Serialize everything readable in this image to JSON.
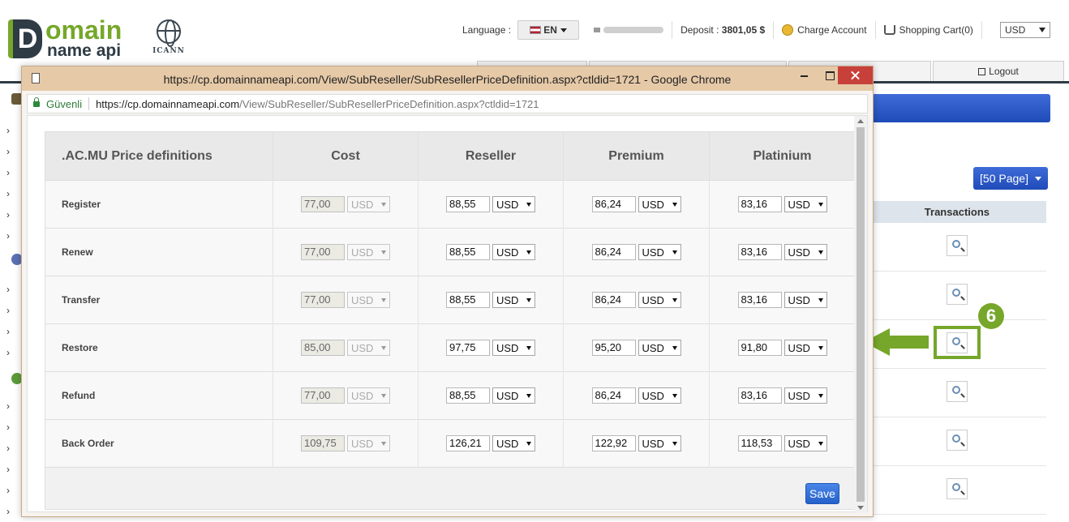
{
  "header": {
    "logo_word1": "omain",
    "logo_letter": "D",
    "logo_word2": "name api",
    "icann_text": "ICANN",
    "language_label": "Language :",
    "language_value": "EN",
    "deposit_label": "Deposit :",
    "deposit_value": "3801,05 $",
    "charge_account": "Charge Account",
    "shopping_cart": "Shopping Cart(0)",
    "currency": "USD"
  },
  "nav": {
    "logout": "Logout"
  },
  "list": {
    "page_button": "[50 Page]",
    "transactions_header": "Transactions"
  },
  "annotation": {
    "step": "6"
  },
  "popup": {
    "title": "https://cp.domainnameapi.com/View/SubReseller/SubResellerPriceDefinition.aspx?ctldid=1721 - Google Chrome",
    "secure_label": "Güvenli",
    "url_domain": "https://cp.domainnameapi.com",
    "url_path": "/View/SubReseller/SubResellerPriceDefinition.aspx?ctldid=1721",
    "table": {
      "title": ".AC.MU Price definitions",
      "columns": [
        "Cost",
        "Reseller",
        "Premium",
        "Platinium"
      ],
      "currency": "USD",
      "rows": [
        {
          "label": "Register",
          "cost": "77,00",
          "reseller": "88,55",
          "premium": "86,24",
          "platinium": "83,16"
        },
        {
          "label": "Renew",
          "cost": "77,00",
          "reseller": "88,55",
          "premium": "86,24",
          "platinium": "83,16"
        },
        {
          "label": "Transfer",
          "cost": "77,00",
          "reseller": "88,55",
          "premium": "86,24",
          "platinium": "83,16"
        },
        {
          "label": "Restore",
          "cost": "85,00",
          "reseller": "97,75",
          "premium": "95,20",
          "platinium": "91,80"
        },
        {
          "label": "Refund",
          "cost": "77,00",
          "reseller": "88,55",
          "premium": "86,24",
          "platinium": "83,16"
        },
        {
          "label": "Back Order",
          "cost": "109,75",
          "reseller": "126,21",
          "premium": "122,92",
          "platinium": "118,53"
        }
      ]
    },
    "save_label": "Save"
  },
  "colors": {
    "brand_green": "#76a72a",
    "titlebar": "#e6c9a7",
    "save_blue": "#2461c9"
  }
}
